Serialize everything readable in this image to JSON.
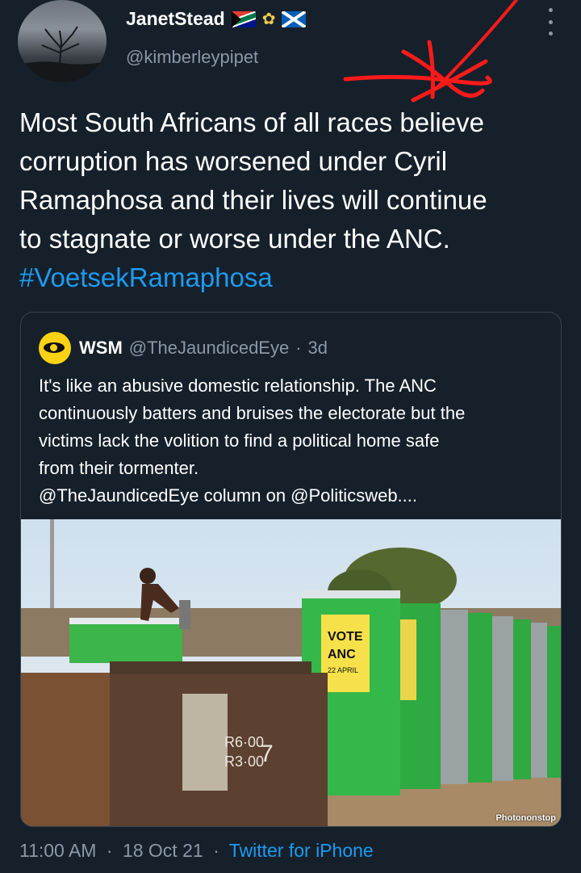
{
  "tweet": {
    "display_name": "JanetStead",
    "handle": "@kimberleypipet",
    "text_lines": [
      "Most South Africans of all races believe",
      "corruption has worsened under Cyril",
      "Ramaphosa and their lives will continue",
      "to stagnate or worse under the ANC."
    ],
    "hashtag": "#VoetsekRamaphosa",
    "icons": [
      "south-africa-flag-icon",
      "bee-icon",
      "scotland-flag-icon",
      "more-options-icon"
    ]
  },
  "quote": {
    "name": "WSM",
    "handle": "@TheJaundicedEye",
    "separator": "·",
    "age": "3d",
    "text_lines": [
      "It's like an abusive domestic relationship. The ANC",
      "continuously batters and bruises the electorate but the",
      "victims lack the volition to find a political home safe",
      "from their tormenter.",
      "@TheJaundicedEye column on @Politicsweb...."
    ],
    "photo": {
      "poster_line1": "VOTE",
      "poster_line2": "ANC",
      "poster_line3": "22 APRIL",
      "wall_text_1": "R6·00",
      "wall_text_2": "R3·00",
      "wall_digit": "7",
      "credit": "Photononstop"
    }
  },
  "footer": {
    "time": "11:00 AM",
    "separator": "·",
    "date": "18 Oct 21",
    "source": "Twitter for iPhone"
  },
  "colors": {
    "background": "#15202b",
    "link": "#1d9bf0",
    "muted": "#8b98a5",
    "border": "#38444d",
    "annotation": "#ff1a1a"
  }
}
